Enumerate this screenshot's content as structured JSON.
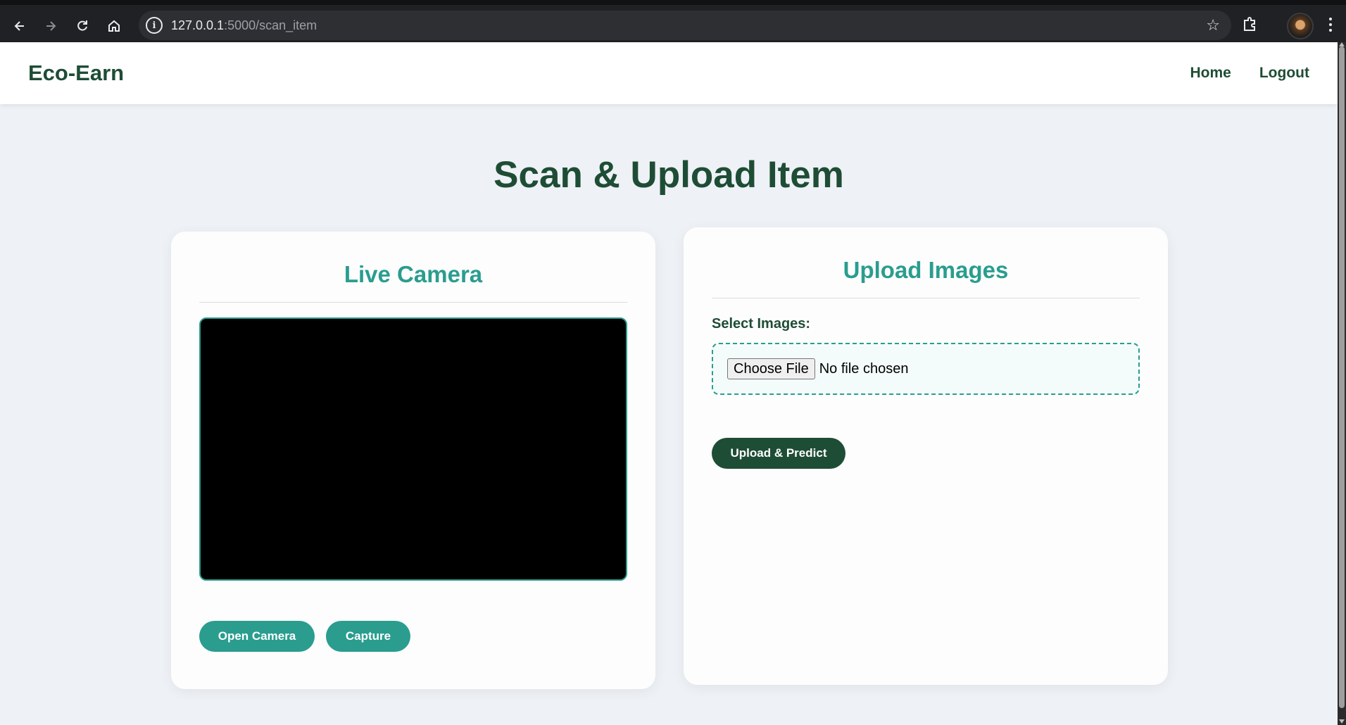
{
  "browser": {
    "url_host": "127.0.0.1",
    "url_rest": ":5000/scan_item",
    "icons": [
      "back-arrow-icon",
      "forward-arrow-icon",
      "reload-icon",
      "home-icon",
      "info-icon",
      "star-icon",
      "extensions-icon",
      "profile-avatar",
      "menu-kebab-icon"
    ]
  },
  "navbar": {
    "brand": "Eco-Earn",
    "links": [
      "Home",
      "Logout"
    ]
  },
  "page_title": "Scan & Upload Item",
  "live_camera": {
    "heading": "Live Camera",
    "open_button": "Open Camera",
    "capture_button": "Capture"
  },
  "upload": {
    "heading": "Upload Images",
    "label": "Select Images:",
    "choose_file": "Choose File",
    "no_file": "No file chosen",
    "submit_button": "Upload & Predict"
  },
  "colors": {
    "brand_dark": "#1e4d35",
    "accent_teal": "#2a9d8f",
    "background": "#eef1f5"
  }
}
